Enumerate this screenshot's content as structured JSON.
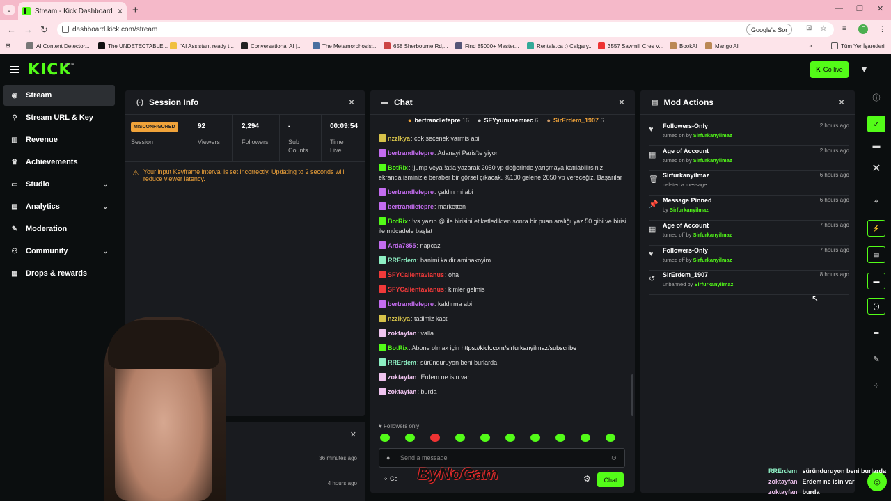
{
  "browser": {
    "tab_title": "Stream - Kick Dashboard",
    "url": "dashboard.kick.com/stream",
    "google_sor": "Google'a Sor",
    "profile_initial": "F",
    "bookmarks": [
      "AI Content Detector...",
      "The UNDETECTABLE...",
      "\"AI Assistant ready t...",
      "Conversational AI |...",
      "The Metamorphosis:...",
      "658 Sherbourne Rd,...",
      "Find 85000+ Master...",
      "Rentals.ca :) Calgary...",
      "3557 Sawmill Cres V...",
      "BookAI",
      "Mango AI"
    ],
    "all_bookmarks": "Tüm Yer İşaretleri"
  },
  "header": {
    "logo": "KICK",
    "beta": "BETA",
    "go_live": "Go live"
  },
  "sidebar": {
    "items": [
      {
        "label": "Stream",
        "icon": "signal-icon"
      },
      {
        "label": "Stream URL & Key",
        "icon": "link-icon"
      },
      {
        "label": "Revenue",
        "icon": "chart-icon"
      },
      {
        "label": "Achievements",
        "icon": "trophy-icon"
      },
      {
        "label": "Studio",
        "icon": "studio-icon"
      },
      {
        "label": "Analytics",
        "icon": "analytics-icon"
      },
      {
        "label": "Moderation",
        "icon": "wrench-icon"
      },
      {
        "label": "Community",
        "icon": "community-icon"
      },
      {
        "label": "Drops & rewards",
        "icon": "gift-icon"
      }
    ]
  },
  "session": {
    "title": "Session Info",
    "badge": "MISCONFIGURED",
    "badge_label": "Session",
    "viewers": "92",
    "viewers_label": "Viewers",
    "followers": "2,294",
    "followers_label": "Followers",
    "subs": "-",
    "subs_label": "Sub Counts",
    "time": "00:09:54",
    "time_label": "Time Live",
    "warning": "Your input Keyframe interval is set incorrectly. Updating to 2 seconds will reduce viewer latency."
  },
  "lower_panel": {
    "time1": "36 minutes ago",
    "time2": "4 hours ago",
    "partial": "d"
  },
  "chat": {
    "title": "Chat",
    "pinned": [
      {
        "name": "bertrandlefepre",
        "count": "16"
      },
      {
        "name": "SFYyunusemrec",
        "count": "6"
      },
      {
        "name": "SirErdem_1907",
        "count": "6"
      }
    ],
    "messages": [
      {
        "user": "nzzlkya",
        "color": "#d6c24a",
        "text": "cok secenek varmis abi"
      },
      {
        "user": "bertrandlefepre",
        "color": "#c46cf0",
        "text": "Adanayi Paris'te yiyor"
      },
      {
        "user": "BotRix",
        "color": "#53fc18",
        "text": "!jump veya !atla yazarak 2050 vp değerinde yarışmaya katılabilirsiniz ekranda isminizle beraber bir görsel çıkacak. %100 gelene 2050 vp vereceğiz. Başarılar"
      },
      {
        "user": "bertrandlefepre",
        "color": "#c46cf0",
        "text": "çaldın mi abi"
      },
      {
        "user": "bertrandlefepre",
        "color": "#c46cf0",
        "text": "marketten"
      },
      {
        "user": "BotRix",
        "color": "#53fc18",
        "text": "!vs yazıp @ ile birisini etiketledikten sonra bir puan aralığı yaz 50 gibi ve birisi ile mücadele başlat"
      },
      {
        "user": "Arda7855",
        "color": "#c46cf0",
        "text": "napcaz"
      },
      {
        "user": "RRErdem",
        "color": "#8ef0c4",
        "text": "banimi kaldir aminakoyim"
      },
      {
        "user": "SFYCalientavianus",
        "color": "#f03a3a",
        "text": "oha"
      },
      {
        "user": "SFYCalientavianus",
        "color": "#f03a3a",
        "text": "kimler gelmis"
      },
      {
        "user": "bertrandlefepre",
        "color": "#c46cf0",
        "text": "kaldırma abi"
      },
      {
        "user": "nzzlkya",
        "color": "#d6c24a",
        "text": "tadimiz kacti"
      },
      {
        "user": "zoktayfan",
        "color": "#f0c4f0",
        "text": "valla"
      },
      {
        "user": "BotRix",
        "color": "#53fc18",
        "text": "Abone olmak için ",
        "link": "https://kick.com/sirfurkanyilmaz/subscribe"
      },
      {
        "user": "RRErdem",
        "color": "#8ef0c4",
        "text": "süründuruyon beni burlarda"
      },
      {
        "user": "zoktayfan",
        "color": "#f0c4f0",
        "text": "Erdem ne isin var"
      },
      {
        "user": "zoktayfan",
        "color": "#f0c4f0",
        "text": "burda"
      }
    ],
    "followers_only": "Followers only",
    "placeholder": "Send a message",
    "send": "Chat",
    "bottom_partial": "Co"
  },
  "mod": {
    "title": "Mod Actions",
    "actions": [
      {
        "title": "Followers-Only",
        "sub": "turned on by",
        "by": "Sirfurkanyilmaz",
        "time": "2 hours ago",
        "icon": "heart-icon"
      },
      {
        "title": "Age of Account",
        "sub": "turned on by",
        "by": "Sirfurkanyilmaz",
        "time": "2 hours ago",
        "icon": "calendar-icon"
      },
      {
        "title": "Sirfurkanyilmaz",
        "sub": "deleted a message",
        "by": "",
        "time": "6 hours ago",
        "icon": "trash-icon"
      },
      {
        "title": "Message Pinned",
        "sub": "by",
        "by": "Sirfurkanyilmaz",
        "time": "6 hours ago",
        "icon": "pin-icon"
      },
      {
        "title": "Age of Account",
        "sub": "turned off by",
        "by": "Sirfurkanyilmaz",
        "time": "7 hours ago",
        "icon": "calendar-icon"
      },
      {
        "title": "Followers-Only",
        "sub": "turned off by",
        "by": "Sirfurkanyilmaz",
        "time": "7 hours ago",
        "icon": "heart-icon"
      },
      {
        "title": "SirErdem_1907",
        "sub": "unbanned by",
        "by": "Sirfurkanyilmaz",
        "time": "8 hours ago",
        "icon": "undo-icon"
      }
    ]
  },
  "overlay": {
    "watermark": "ByNoGam",
    "chat": [
      {
        "user": "RRErdem",
        "text": "süründuruyon beni burlarda"
      },
      {
        "user": "zoktayfan",
        "text": "Erdem ne isin var"
      },
      {
        "user": "zoktayfan",
        "text": "burda"
      }
    ]
  },
  "colors": {
    "accent": "#53fc18",
    "warning": "#f0a33a",
    "panel": "#191b1f",
    "bg": "#0b0e0f"
  }
}
